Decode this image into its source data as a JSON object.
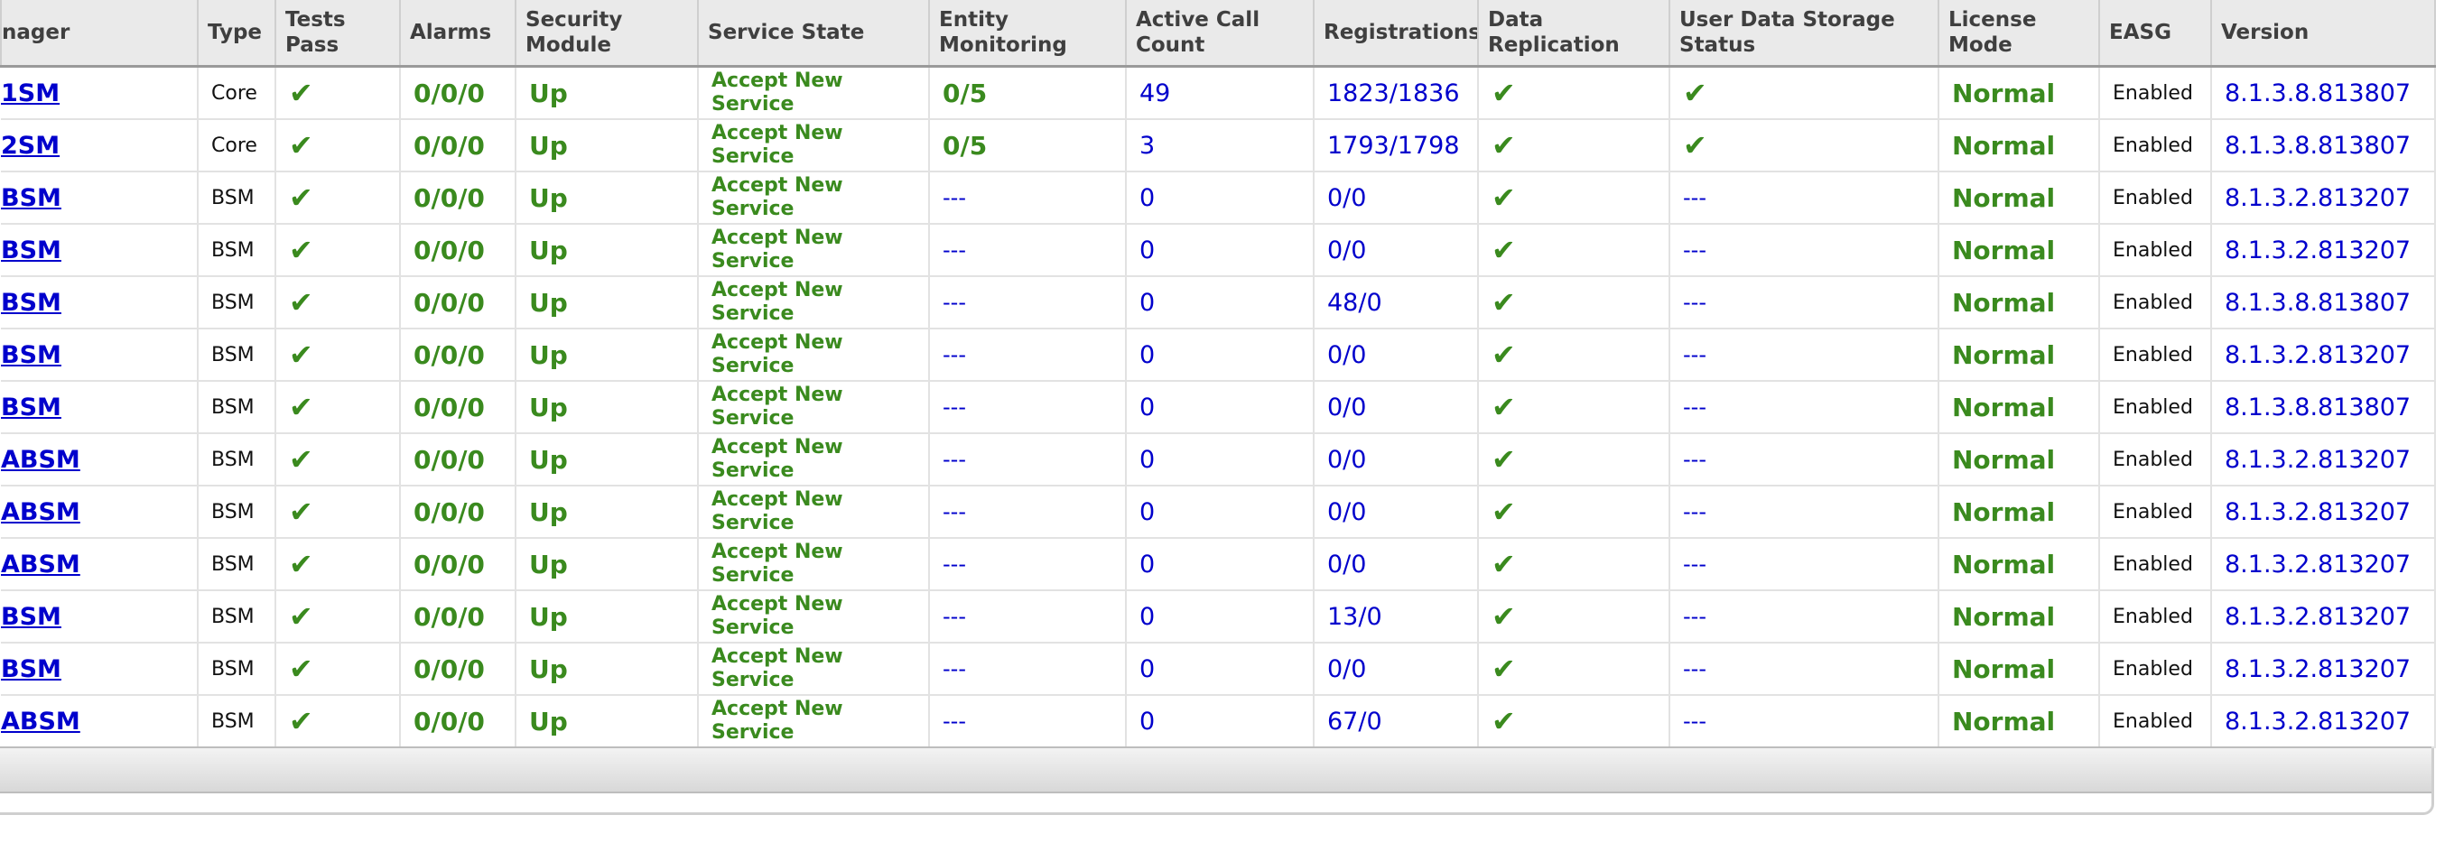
{
  "columns": [
    "nager",
    "Type",
    "Tests Pass",
    "Alarms",
    "Security Module",
    "Service State",
    "Entity Monitoring",
    "Active Call Count",
    "Registrations",
    "Data Replication",
    "User Data Storage Status",
    "License Mode",
    "EASG",
    "Version"
  ],
  "check_glyph": "✔",
  "colors": {
    "ok_green": "#3a8a1e",
    "link_blue": "#0000cc",
    "header_bg": "#eaeaea"
  },
  "rows": [
    {
      "name": "1SM",
      "type": "Core",
      "alarms": "0/0/0",
      "security": "Up",
      "service": "Accept New Service",
      "entity": "0/5",
      "calls": "49",
      "registrations": "1823/1836",
      "user_storage": "✔",
      "license": "Normal",
      "easg": "Enabled",
      "version": "8.1.3.8.813807"
    },
    {
      "name": "2SM",
      "type": "Core",
      "alarms": "0/0/0",
      "security": "Up",
      "service": "Accept New Service",
      "entity": "0/5",
      "calls": "3",
      "registrations": "1793/1798",
      "user_storage": "✔",
      "license": "Normal",
      "easg": "Enabled",
      "version": "8.1.3.8.813807"
    },
    {
      "name": "BSM",
      "type": "BSM",
      "alarms": "0/0/0",
      "security": "Up",
      "service": "Accept New Service",
      "entity": "---",
      "calls": "0",
      "registrations": "0/0",
      "user_storage": "---",
      "license": "Normal",
      "easg": "Enabled",
      "version": "8.1.3.2.813207"
    },
    {
      "name": "BSM",
      "type": "BSM",
      "alarms": "0/0/0",
      "security": "Up",
      "service": "Accept New Service",
      "entity": "---",
      "calls": "0",
      "registrations": "0/0",
      "user_storage": "---",
      "license": "Normal",
      "easg": "Enabled",
      "version": "8.1.3.2.813207"
    },
    {
      "name": "BSM",
      "type": "BSM",
      "alarms": "0/0/0",
      "security": "Up",
      "service": "Accept New Service",
      "entity": "---",
      "calls": "0",
      "registrations": "48/0",
      "user_storage": "---",
      "license": "Normal",
      "easg": "Enabled",
      "version": "8.1.3.8.813807"
    },
    {
      "name": "BSM",
      "type": "BSM",
      "alarms": "0/0/0",
      "security": "Up",
      "service": "Accept New Service",
      "entity": "---",
      "calls": "0",
      "registrations": "0/0",
      "user_storage": "---",
      "license": "Normal",
      "easg": "Enabled",
      "version": "8.1.3.2.813207"
    },
    {
      "name": "BSM",
      "type": "BSM",
      "alarms": "0/0/0",
      "security": "Up",
      "service": "Accept New Service",
      "entity": "---",
      "calls": "0",
      "registrations": "0/0",
      "user_storage": "---",
      "license": "Normal",
      "easg": "Enabled",
      "version": "8.1.3.8.813807"
    },
    {
      "name": "ABSM",
      "type": "BSM",
      "alarms": "0/0/0",
      "security": "Up",
      "service": "Accept New Service",
      "entity": "---",
      "calls": "0",
      "registrations": "0/0",
      "user_storage": "---",
      "license": "Normal",
      "easg": "Enabled",
      "version": "8.1.3.2.813207"
    },
    {
      "name": "ABSM",
      "type": "BSM",
      "alarms": "0/0/0",
      "security": "Up",
      "service": "Accept New Service",
      "entity": "---",
      "calls": "0",
      "registrations": "0/0",
      "user_storage": "---",
      "license": "Normal",
      "easg": "Enabled",
      "version": "8.1.3.2.813207"
    },
    {
      "name": "ABSM",
      "type": "BSM",
      "alarms": "0/0/0",
      "security": "Up",
      "service": "Accept New Service",
      "entity": "---",
      "calls": "0",
      "registrations": "0/0",
      "user_storage": "---",
      "license": "Normal",
      "easg": "Enabled",
      "version": "8.1.3.2.813207"
    },
    {
      "name": "BSM",
      "type": "BSM",
      "alarms": "0/0/0",
      "security": "Up",
      "service": "Accept New Service",
      "entity": "---",
      "calls": "0",
      "registrations": "13/0",
      "user_storage": "---",
      "license": "Normal",
      "easg": "Enabled",
      "version": "8.1.3.2.813207"
    },
    {
      "name": "BSM",
      "type": "BSM",
      "alarms": "0/0/0",
      "security": "Up",
      "service": "Accept New Service",
      "entity": "---",
      "calls": "0",
      "registrations": "0/0",
      "user_storage": "---",
      "license": "Normal",
      "easg": "Enabled",
      "version": "8.1.3.2.813207"
    },
    {
      "name": "ABSM",
      "type": "BSM",
      "alarms": "0/0/0",
      "security": "Up",
      "service": "Accept New Service",
      "entity": "---",
      "calls": "0",
      "registrations": "67/0",
      "user_storage": "---",
      "license": "Normal",
      "easg": "Enabled",
      "version": "8.1.3.2.813207"
    }
  ]
}
